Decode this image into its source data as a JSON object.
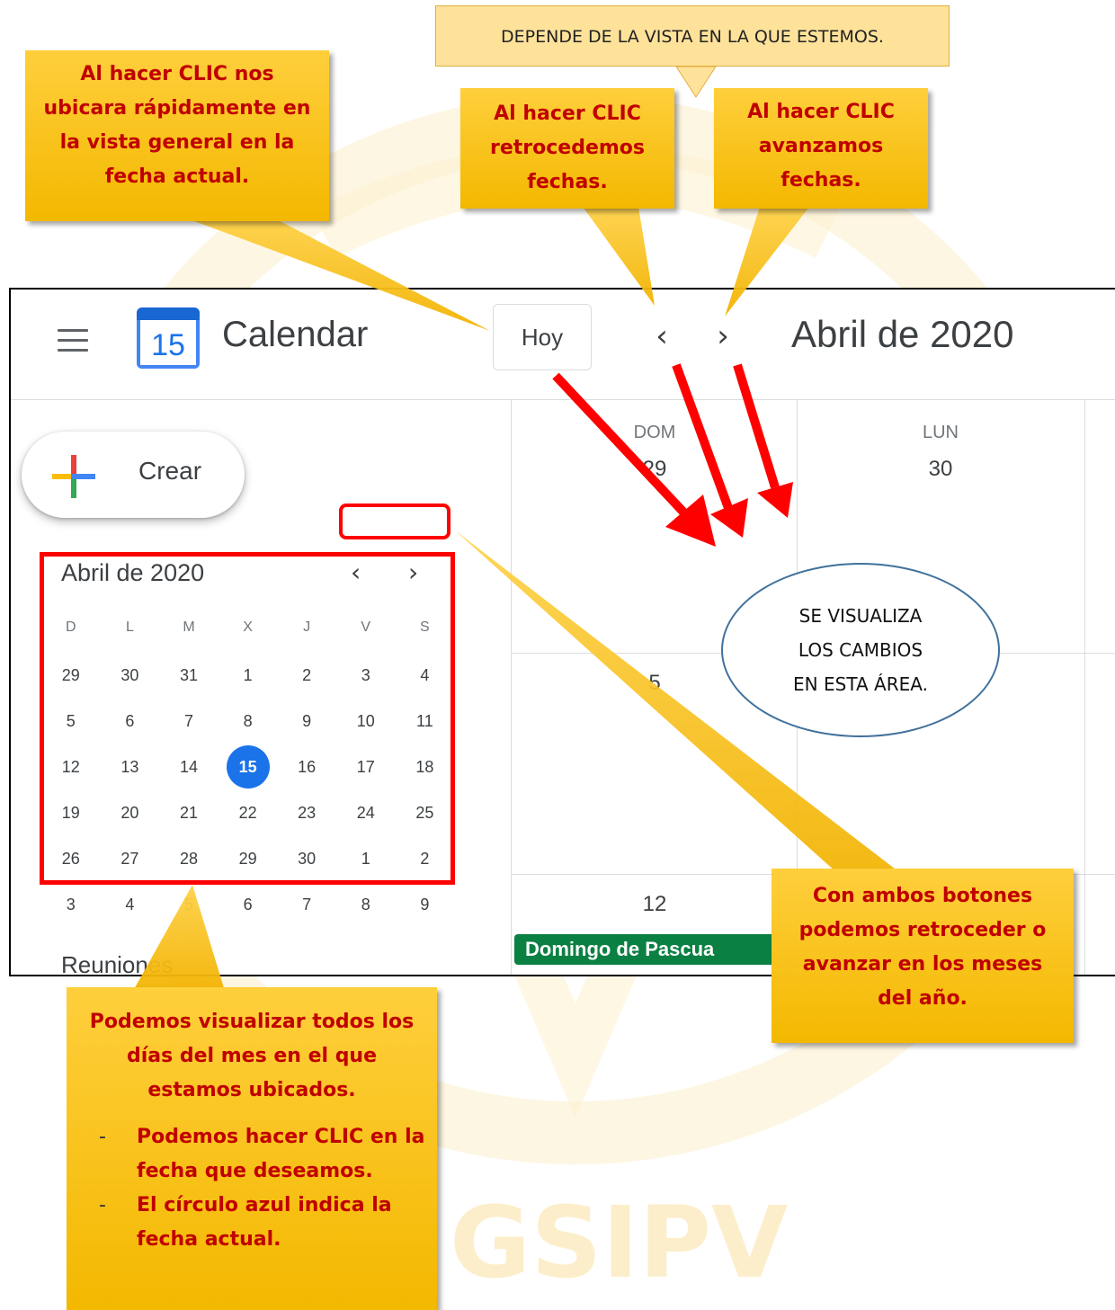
{
  "colors": {
    "callout_fill": "#ffc000",
    "callout_text": "#c00000",
    "arrow_red": "#ff0000",
    "today_blue": "#1a73e8",
    "event_green": "#0b8043"
  },
  "watermark": {
    "text": "GSIPV"
  },
  "app": {
    "menu_icon": "hamburger-menu-icon",
    "logo_number": "15",
    "title": "Calendar",
    "today_button": "Hoy",
    "prev_icon": "chevron-left-icon",
    "next_icon": "chevron-right-icon",
    "prev_glyph": "‹",
    "next_glyph": "›",
    "month_title": "Abril de 2020"
  },
  "sidebar": {
    "create_label": "Crear",
    "create_icon": "plus-multicolor-icon",
    "mini_month_title": "Abril de 2020",
    "weekday_headers": [
      "D",
      "L",
      "M",
      "X",
      "J",
      "V",
      "S"
    ],
    "weeks": [
      [
        "29",
        "30",
        "31",
        "1",
        "2",
        "3",
        "4"
      ],
      [
        "5",
        "6",
        "7",
        "8",
        "9",
        "10",
        "11"
      ],
      [
        "12",
        "13",
        "14",
        "15",
        "16",
        "17",
        "18"
      ],
      [
        "19",
        "20",
        "21",
        "22",
        "23",
        "24",
        "25"
      ],
      [
        "26",
        "27",
        "28",
        "29",
        "30",
        "1",
        "2"
      ],
      [
        "3",
        "4",
        "5",
        "6",
        "7",
        "8",
        "9"
      ]
    ],
    "today_date": "15",
    "section_label": "Reuniones"
  },
  "main_grid": {
    "day_names": [
      "DOM",
      "LUN"
    ],
    "first_week_numbers": [
      "29",
      "30"
    ],
    "second_week_number": "5",
    "third_week_number": "12",
    "event_label": "Domingo de Pascua"
  },
  "annotations": {
    "depende_note": "DEPENDE DE LA VISTA EN LA QUE ESTEMOS.",
    "hoy_callout": [
      "Al hacer CLIC nos",
      "ubicara rápidamente en",
      "la vista general en la",
      "fecha actual."
    ],
    "retro_callout": [
      "Al hacer CLIC",
      "retrocedemos",
      "fechas."
    ],
    "avanz_callout": [
      "Al hacer CLIC",
      "avanzamos",
      "fechas."
    ],
    "ambos_callout": [
      "Con ambos botones",
      "podemos retroceder o",
      "avanzar en los meses",
      "del año."
    ],
    "mes_callout_intro": [
      "Podemos visualizar todos los",
      "días del mes en el que",
      "estamos ubicados."
    ],
    "mes_callout_bullets": [
      [
        "Podemos hacer CLIC en la",
        "fecha que deseamos."
      ],
      [
        "El círculo azul indica la",
        "fecha actual."
      ]
    ],
    "ellipse_note": [
      "SE VISUALIZA",
      "LOS CAMBIOS",
      "EN ESTA ÁREA."
    ]
  }
}
